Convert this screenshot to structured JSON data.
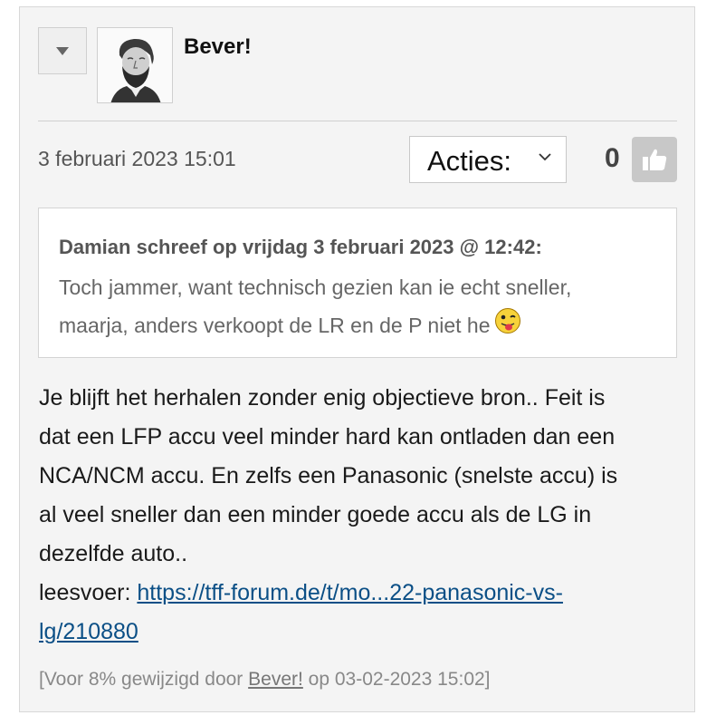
{
  "post": {
    "author": "Bever!",
    "timestamp": "3 februari 2023 15:01",
    "actions_label": "Acties:",
    "like_count": "0"
  },
  "quote": {
    "header": "Damian schreef op vrijdag 3 februari 2023 @ 12:42:",
    "line1": "Toch jammer, want technisch gezien kan ie echt sneller,",
    "line2": "maarja, anders verkoopt de LR en de P niet he"
  },
  "body": {
    "line1": "Je blijft het herhalen zonder enig objectieve bron.. Feit is",
    "line2": "dat een LFP accu veel minder hard kan ontladen dan een",
    "line3": "NCA/NCM accu. En zelfs een Panasonic (snelste accu) is",
    "line4": "al veel sneller dan een minder goede accu als de LG in",
    "line5": "dezelfde auto..",
    "link_prefix": "leesvoer: ",
    "link_text_1": "https://tff-forum.de/t/mo...22-panasonic-vs-",
    "link_text_2": "lg/210880"
  },
  "edit_note": {
    "prefix": "[Voor 8% gewijzigd door ",
    "user": "Bever!",
    "suffix": " op 03-02-2023 15:02]"
  },
  "icons": {
    "menu": "caret-down-icon",
    "like": "thumbs-up-icon",
    "chevron": "chevron-down-icon",
    "emoticon": "tongue-out-smiley-icon"
  },
  "colors": {
    "link": "#0b4f86",
    "like_button": "#c8c8c8",
    "card_background": "#f4f4f4"
  }
}
